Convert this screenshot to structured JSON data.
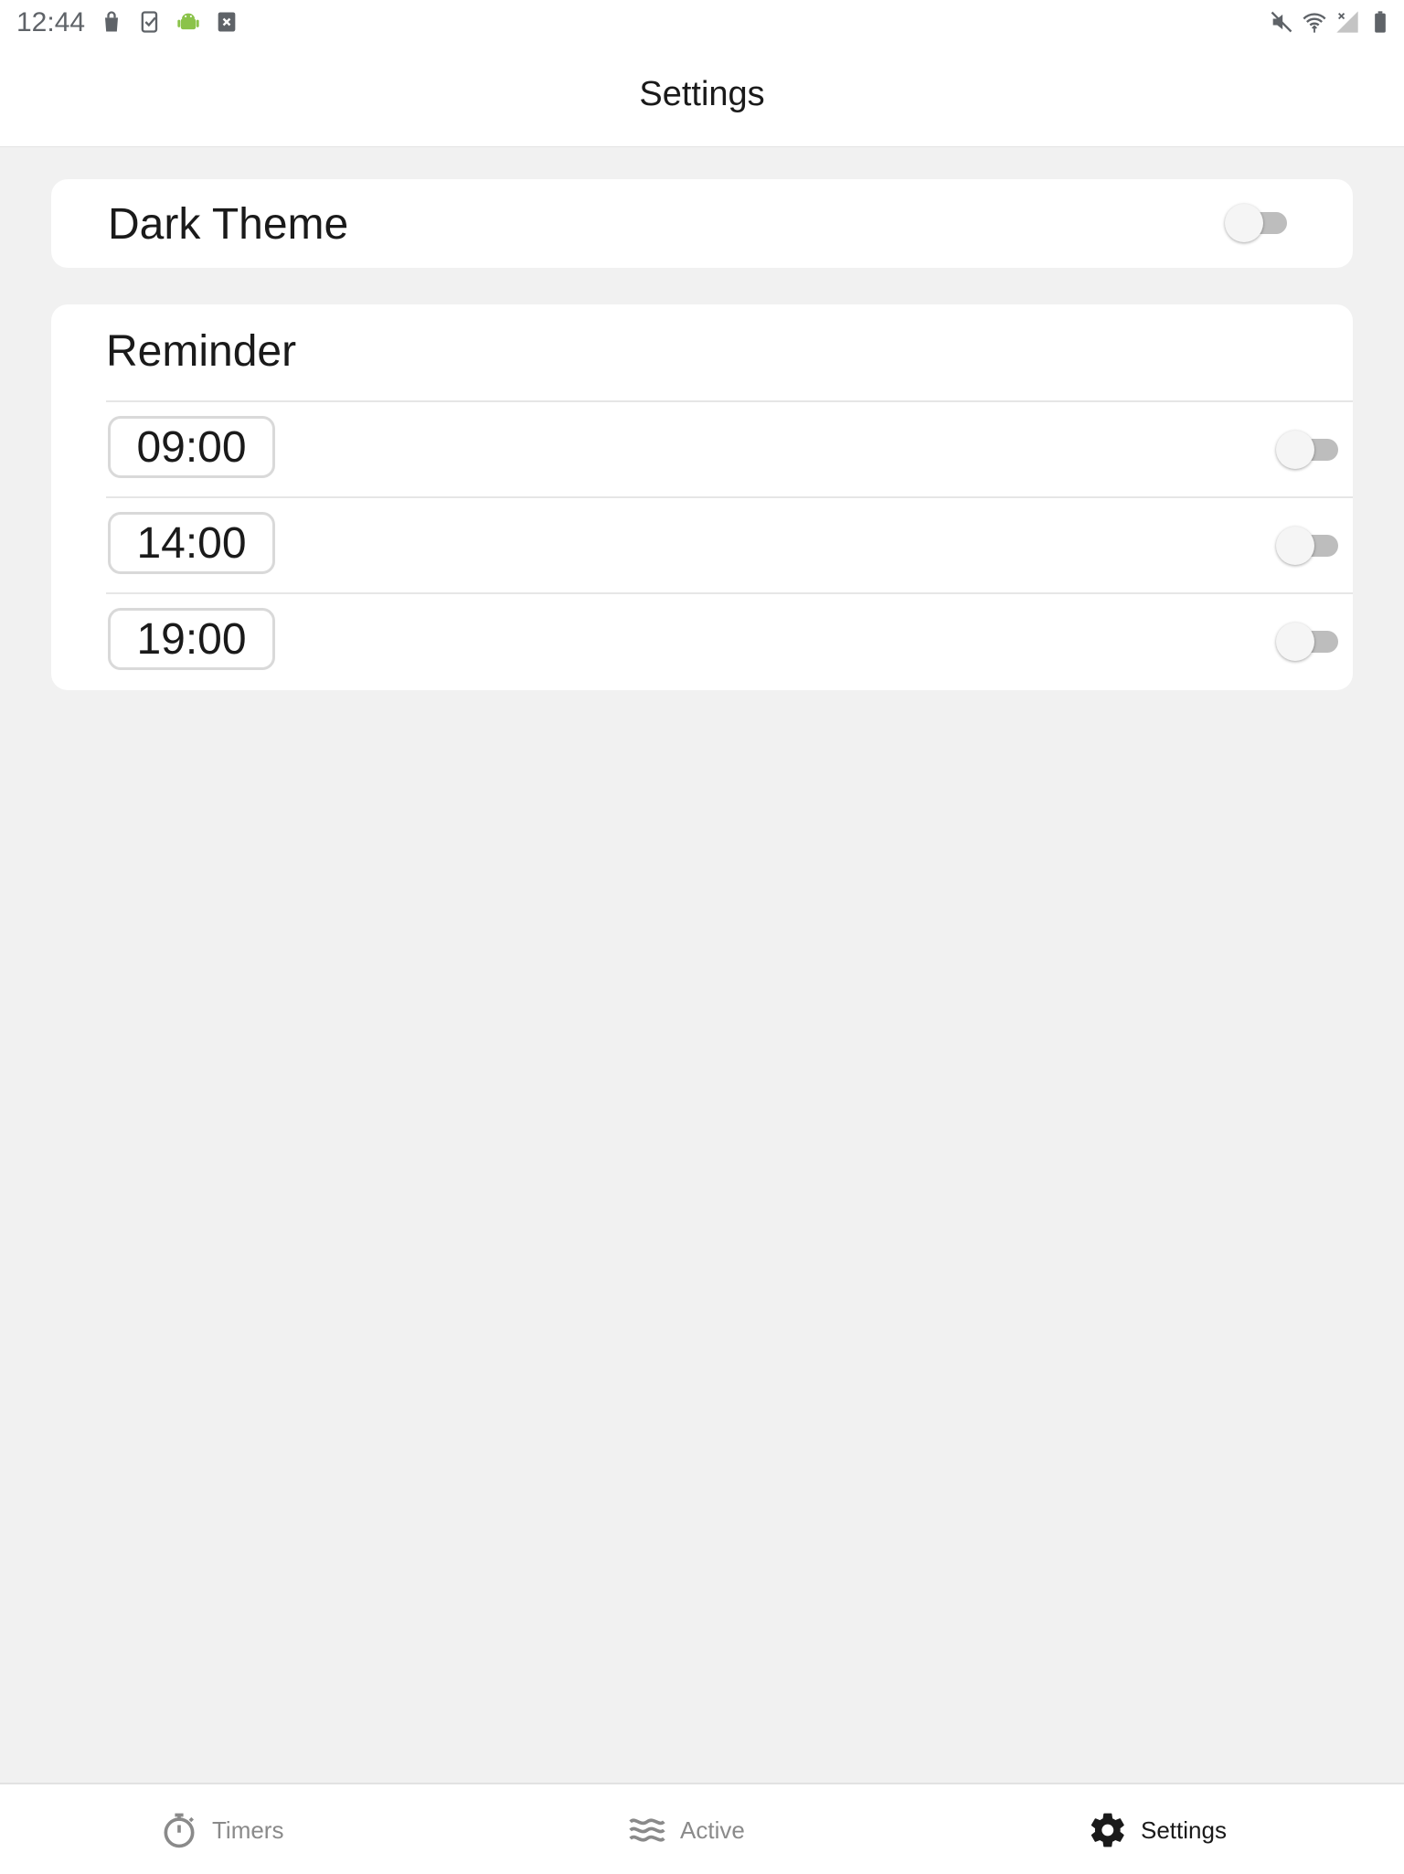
{
  "status_bar": {
    "time": "12:44",
    "left_icons": [
      "shopping-bag-icon",
      "checklist-phone-icon",
      "android-icon",
      "close-box-icon"
    ],
    "right_icons": [
      "mute-icon",
      "wifi-icon",
      "no-signal-icon",
      "battery-icon"
    ]
  },
  "app_bar": {
    "title": "Settings"
  },
  "dark_theme": {
    "label": "Dark Theme",
    "enabled": false
  },
  "reminder": {
    "title": "Reminder",
    "times": [
      {
        "time": "09:00",
        "enabled": false
      },
      {
        "time": "14:00",
        "enabled": false
      },
      {
        "time": "19:00",
        "enabled": false
      }
    ]
  },
  "bottom_nav": {
    "items": [
      {
        "label": "Timers",
        "icon": "stopwatch-icon",
        "selected": false
      },
      {
        "label": "Active",
        "icon": "waves-icon",
        "selected": false
      },
      {
        "label": "Settings",
        "icon": "gear-icon",
        "selected": true
      }
    ]
  },
  "colors": {
    "background": "#f1f1f1",
    "card": "#ffffff",
    "switch_track_off": "#bdbdbd",
    "switch_thumb_off": "#f5f5f5",
    "nav_inactive": "#8a8a8a",
    "nav_active": "#1a1a1a"
  }
}
